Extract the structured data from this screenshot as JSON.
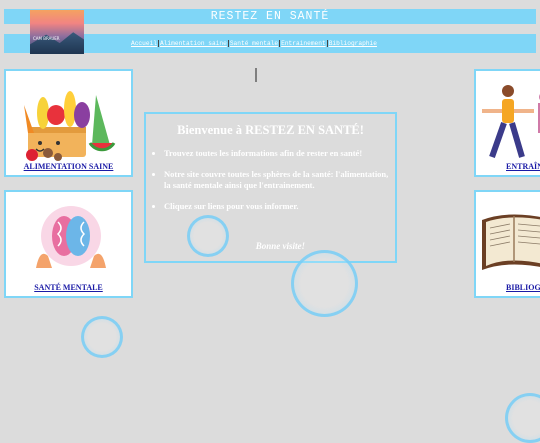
{
  "header": {
    "site_title": "RESTEZ EN SANTÉ",
    "logo_text": "CAM\nBRAUER"
  },
  "nav": {
    "items": [
      "Accueil",
      "Alimentation saine",
      "Santé mentale",
      "Entrainement",
      "Bibliographie"
    ]
  },
  "cards": {
    "alimentation": "ALIMENTATION SAINE",
    "sante_mentale": "SANTÉ MENTALE",
    "entrainement": "ENTRAÎN",
    "bibliographie": "BIBLIOG"
  },
  "welcome": {
    "title": "Bienvenue à RESTEZ EN SANTÉ!",
    "points": [
      "Trouvez toutes les informations afin de rester en santé!",
      "Notre site couvre toutes les sphères de la santé: l'alimentation, la santé mentale ainsi que l'entrainement.",
      "Cliquez sur liens pour vous informer."
    ],
    "closing": "Bonne visite!"
  },
  "colors": {
    "accent": "#7fd6f7",
    "background": "#dcdcdc",
    "link": "#1a1aa6"
  }
}
